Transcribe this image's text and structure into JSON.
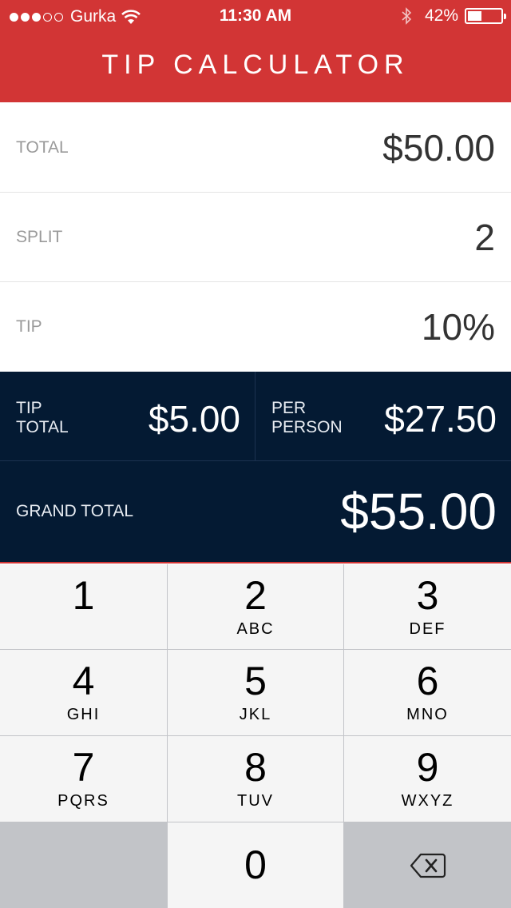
{
  "status_bar": {
    "carrier": "Gurka",
    "time": "11:30 AM",
    "battery": "42%",
    "signal_bars_filled": 3,
    "signal_bars_total": 5,
    "battery_level": 0.42
  },
  "header": {
    "title": "TIP CALCULATOR"
  },
  "inputs": {
    "total": {
      "label": "TOTAL",
      "value": "$50.00"
    },
    "split": {
      "label": "SPLIT",
      "value": "2"
    },
    "tip": {
      "label": "TIP",
      "value": "10%"
    }
  },
  "results": {
    "tip_total": {
      "label_line1": "TIP",
      "label_line2": "TOTAL",
      "value": "$5.00"
    },
    "per_person": {
      "label_line1": "PER",
      "label_line2": "PERSON",
      "value": "$27.50"
    },
    "grand_total": {
      "label": "GRAND TOTAL",
      "value": "$55.00"
    }
  },
  "keypad": {
    "keys": [
      {
        "digit": "1",
        "letters": ""
      },
      {
        "digit": "2",
        "letters": "ABC"
      },
      {
        "digit": "3",
        "letters": "DEF"
      },
      {
        "digit": "4",
        "letters": "GHI"
      },
      {
        "digit": "5",
        "letters": "JKL"
      },
      {
        "digit": "6",
        "letters": "MNO"
      },
      {
        "digit": "7",
        "letters": "PQRS"
      },
      {
        "digit": "8",
        "letters": "TUV"
      },
      {
        "digit": "9",
        "letters": "WXYZ"
      },
      {
        "digit": "0",
        "letters": ""
      }
    ],
    "delete_icon": "backspace-icon"
  },
  "colors": {
    "header_red": "#d23535",
    "results_navy": "#041a33",
    "keypad_gray": "#c2c4c8"
  }
}
